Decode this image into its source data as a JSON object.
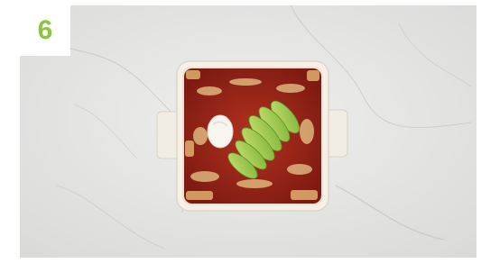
{
  "step": {
    "number": "6",
    "color": "#8bc43f"
  },
  "photo": {
    "subject_icon": "enchilada-baking-dish-photo",
    "background": "white-marble",
    "colors": {
      "marble": "#e6e6e6",
      "dish": "#f3efe6",
      "sauce": "#a3261c",
      "cheese": "#e8c98a",
      "avocado": "#9cc94a",
      "sour_cream": "#f7f5ef"
    }
  }
}
